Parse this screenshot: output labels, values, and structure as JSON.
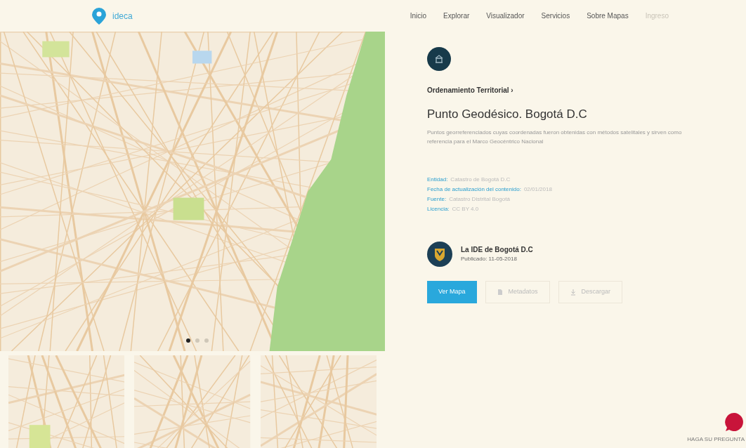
{
  "header": {
    "logo_text": "ideca",
    "nav": [
      {
        "label": "Inicio",
        "selected": false
      },
      {
        "label": "Explorar",
        "selected": false
      },
      {
        "label": "Visualizador",
        "selected": false
      },
      {
        "label": "Servicios",
        "selected": false
      },
      {
        "label": "Sobre Mapas",
        "selected": false
      },
      {
        "label": "Ingreso",
        "selected": false,
        "kind": "muted"
      }
    ]
  },
  "gallery": {
    "dots": [
      {
        "selected": true
      },
      {
        "selected": false
      },
      {
        "selected": false
      }
    ]
  },
  "detail": {
    "breadcrumb": "Ordenamiento Territorial ›",
    "title": "Punto Geodésico. Bogotá D.C",
    "description": "Puntos georreferenciados cuyas coordenadas fueron obtenidas con métodos satelitales y sirven como referencia para el Marco Geocéntrico Nacional",
    "fields": [
      {
        "label": "Entidad:",
        "value": "Catastro de Bogotá D.C"
      },
      {
        "label": "Fecha de actualización del contenido:",
        "value": "02/01/2018"
      },
      {
        "label": "Fuente:",
        "value": "Catastro Distrital Bogotá"
      },
      {
        "label": "Licencia:",
        "value": "CC BY 4.0"
      }
    ],
    "publisher": {
      "name": "La IDE de Bogotá D.C",
      "published": "Publicado: 11-05-2018"
    },
    "buttons": [
      {
        "label": "Ver Mapa",
        "kind": "primary"
      },
      {
        "label": "Metadatos",
        "kind": "metadata"
      },
      {
        "label": "Descargar",
        "kind": "download"
      }
    ]
  },
  "help": {
    "label": "HAGA SU PREGUNTA"
  }
}
